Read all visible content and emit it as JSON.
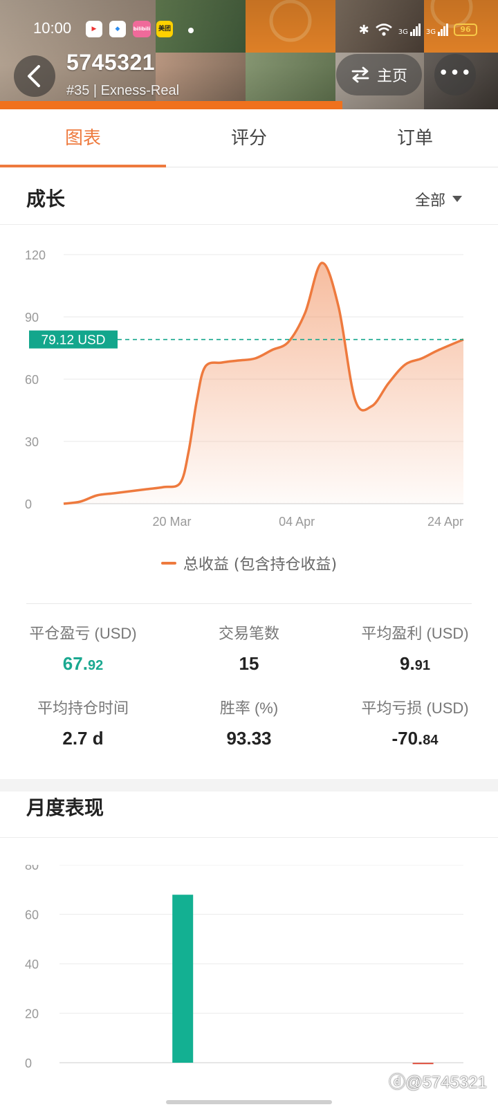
{
  "status_bar": {
    "time": "10:00",
    "apps": [
      "bilibili",
      "美团"
    ],
    "signal1": "3G",
    "signal2": "3G",
    "battery": "96"
  },
  "header": {
    "account_id": "5745321",
    "rank_line": "#35 | Exness-Real",
    "home_label": "主页",
    "more_label": "•••"
  },
  "tabs": [
    {
      "label": "图表",
      "active": true
    },
    {
      "label": "评分",
      "active": false
    },
    {
      "label": "订单",
      "active": false
    }
  ],
  "growth": {
    "title": "成长",
    "filter_label": "全部"
  },
  "chart_data": [
    {
      "type": "area",
      "x_ticks": [
        "20 Mar",
        "04 Apr",
        "24 Apr"
      ],
      "y_ticks": [
        0,
        30,
        60,
        90,
        120
      ],
      "ylim": [
        0,
        120
      ],
      "series": [
        {
          "name": "总收益 (包含持仓收益)",
          "color": "#ee7a3e",
          "x": [
            "2024-03-07",
            "2024-03-09",
            "2024-03-11",
            "2024-03-13",
            "2024-03-15",
            "2024-03-17",
            "2024-03-19",
            "2024-03-21",
            "2024-03-22",
            "2024-03-23",
            "2024-03-24",
            "2024-03-26",
            "2024-03-28",
            "2024-03-30",
            "2024-04-01",
            "2024-04-03",
            "2024-04-05",
            "2024-04-07",
            "2024-04-09",
            "2024-04-11",
            "2024-04-13",
            "2024-04-15",
            "2024-04-17",
            "2024-04-19",
            "2024-04-21",
            "2024-04-24"
          ],
          "values": [
            0,
            1,
            4,
            5,
            6,
            7,
            8,
            10,
            25,
            50,
            66,
            68,
            69,
            70,
            74,
            78,
            92,
            116,
            95,
            50,
            47,
            58,
            67,
            70,
            74,
            79.12
          ]
        }
      ],
      "current_value_label": "79.12 USD",
      "current_value": 79.12,
      "grid": true
    },
    {
      "type": "bar",
      "y_ticks": [
        0,
        20,
        40,
        60,
        80
      ],
      "ylim": [
        0,
        80
      ],
      "series": [
        {
          "color": "#13b092",
          "values": [
            0,
            67.92,
            0,
            0,
            -0.6
          ]
        }
      ],
      "grid": true
    }
  ],
  "stats": [
    {
      "label": "平仓盈亏 (USD)",
      "value_main": "67.",
      "value_small": "92",
      "highlight": true
    },
    {
      "label": "交易笔数",
      "value_main": "15",
      "value_small": "",
      "highlight": false
    },
    {
      "label": "平均盈利 (USD)",
      "value_main": "9.",
      "value_small": "91",
      "highlight": false
    },
    {
      "label": "平均持仓时间",
      "value_main": "2.7 d",
      "value_small": "",
      "highlight": false
    },
    {
      "label": "胜率 (%)",
      "value_main": "93.33",
      "value_small": "",
      "highlight": false
    },
    {
      "label": "平均亏损 (USD)",
      "value_main": "-70.",
      "value_small": "84",
      "highlight": false
    }
  ],
  "monthly": {
    "title": "月度表现"
  },
  "watermark": "@5745321"
}
